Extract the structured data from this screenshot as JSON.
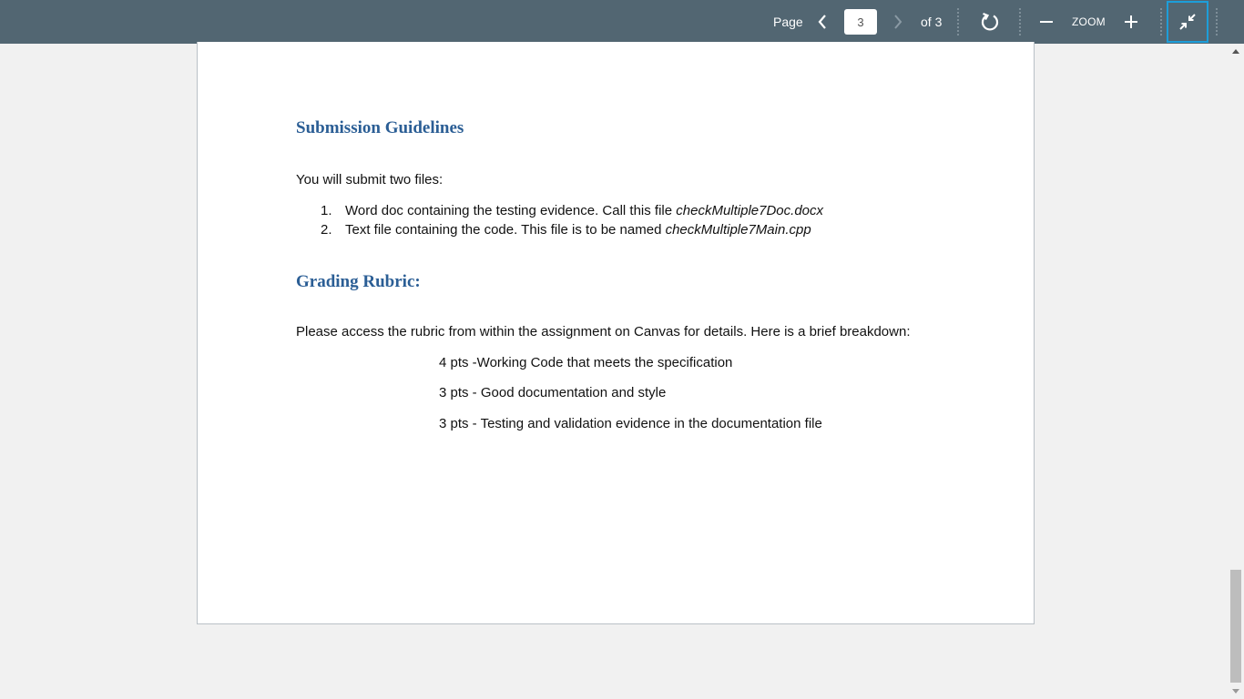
{
  "toolbar": {
    "page_label": "Page",
    "current_page": "3",
    "of_label": "of 3",
    "zoom_label": "ZOOM",
    "icons": {
      "prev": "chevron-left-icon",
      "next": "chevron-right-icon",
      "rotate": "rotate-icon",
      "zoom_out": "minus-icon",
      "zoom_in": "plus-icon",
      "collapse": "collapse-icon"
    },
    "accent_color": "#1d9ed9",
    "bg_color": "#526672"
  },
  "document": {
    "heading1": "Submission Guidelines",
    "intro": "You will submit two files:",
    "list": [
      {
        "num": "1.",
        "text": "Word doc containing the testing evidence. Call this file ",
        "file": "checkMultiple7Doc.docx"
      },
      {
        "num": "2.",
        "text": "Text file containing the code. This file is to be named ",
        "file": "checkMultiple7Main.cpp"
      }
    ],
    "heading2": "Grading Rubric:",
    "rubric_intro": "Please access the rubric from within the assignment on Canvas for details. Here is a brief breakdown:",
    "rubric": [
      "4 pts -Working Code that meets the specification",
      "3 pts - Good documentation and style",
      "3 pts - Testing and validation evidence in the documentation file"
    ],
    "heading_color": "#2b5e95"
  }
}
